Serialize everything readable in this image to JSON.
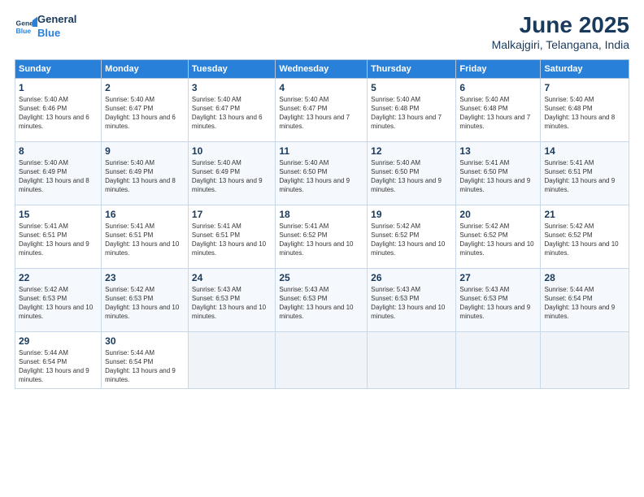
{
  "logo": {
    "line1": "General",
    "line2": "Blue"
  },
  "title": "June 2025",
  "subtitle": "Malkajgiri, Telangana, India",
  "weekdays": [
    "Sunday",
    "Monday",
    "Tuesday",
    "Wednesday",
    "Thursday",
    "Friday",
    "Saturday"
  ],
  "weeks": [
    [
      {
        "day": "1",
        "sunrise": "Sunrise: 5:40 AM",
        "sunset": "Sunset: 6:46 PM",
        "daylight": "Daylight: 13 hours and 6 minutes."
      },
      {
        "day": "2",
        "sunrise": "Sunrise: 5:40 AM",
        "sunset": "Sunset: 6:47 PM",
        "daylight": "Daylight: 13 hours and 6 minutes."
      },
      {
        "day": "3",
        "sunrise": "Sunrise: 5:40 AM",
        "sunset": "Sunset: 6:47 PM",
        "daylight": "Daylight: 13 hours and 6 minutes."
      },
      {
        "day": "4",
        "sunrise": "Sunrise: 5:40 AM",
        "sunset": "Sunset: 6:47 PM",
        "daylight": "Daylight: 13 hours and 7 minutes."
      },
      {
        "day": "5",
        "sunrise": "Sunrise: 5:40 AM",
        "sunset": "Sunset: 6:48 PM",
        "daylight": "Daylight: 13 hours and 7 minutes."
      },
      {
        "day": "6",
        "sunrise": "Sunrise: 5:40 AM",
        "sunset": "Sunset: 6:48 PM",
        "daylight": "Daylight: 13 hours and 7 minutes."
      },
      {
        "day": "7",
        "sunrise": "Sunrise: 5:40 AM",
        "sunset": "Sunset: 6:48 PM",
        "daylight": "Daylight: 13 hours and 8 minutes."
      }
    ],
    [
      {
        "day": "8",
        "sunrise": "Sunrise: 5:40 AM",
        "sunset": "Sunset: 6:49 PM",
        "daylight": "Daylight: 13 hours and 8 minutes."
      },
      {
        "day": "9",
        "sunrise": "Sunrise: 5:40 AM",
        "sunset": "Sunset: 6:49 PM",
        "daylight": "Daylight: 13 hours and 8 minutes."
      },
      {
        "day": "10",
        "sunrise": "Sunrise: 5:40 AM",
        "sunset": "Sunset: 6:49 PM",
        "daylight": "Daylight: 13 hours and 9 minutes."
      },
      {
        "day": "11",
        "sunrise": "Sunrise: 5:40 AM",
        "sunset": "Sunset: 6:50 PM",
        "daylight": "Daylight: 13 hours and 9 minutes."
      },
      {
        "day": "12",
        "sunrise": "Sunrise: 5:40 AM",
        "sunset": "Sunset: 6:50 PM",
        "daylight": "Daylight: 13 hours and 9 minutes."
      },
      {
        "day": "13",
        "sunrise": "Sunrise: 5:41 AM",
        "sunset": "Sunset: 6:50 PM",
        "daylight": "Daylight: 13 hours and 9 minutes."
      },
      {
        "day": "14",
        "sunrise": "Sunrise: 5:41 AM",
        "sunset": "Sunset: 6:51 PM",
        "daylight": "Daylight: 13 hours and 9 minutes."
      }
    ],
    [
      {
        "day": "15",
        "sunrise": "Sunrise: 5:41 AM",
        "sunset": "Sunset: 6:51 PM",
        "daylight": "Daylight: 13 hours and 9 minutes."
      },
      {
        "day": "16",
        "sunrise": "Sunrise: 5:41 AM",
        "sunset": "Sunset: 6:51 PM",
        "daylight": "Daylight: 13 hours and 10 minutes."
      },
      {
        "day": "17",
        "sunrise": "Sunrise: 5:41 AM",
        "sunset": "Sunset: 6:51 PM",
        "daylight": "Daylight: 13 hours and 10 minutes."
      },
      {
        "day": "18",
        "sunrise": "Sunrise: 5:41 AM",
        "sunset": "Sunset: 6:52 PM",
        "daylight": "Daylight: 13 hours and 10 minutes."
      },
      {
        "day": "19",
        "sunrise": "Sunrise: 5:42 AM",
        "sunset": "Sunset: 6:52 PM",
        "daylight": "Daylight: 13 hours and 10 minutes."
      },
      {
        "day": "20",
        "sunrise": "Sunrise: 5:42 AM",
        "sunset": "Sunset: 6:52 PM",
        "daylight": "Daylight: 13 hours and 10 minutes."
      },
      {
        "day": "21",
        "sunrise": "Sunrise: 5:42 AM",
        "sunset": "Sunset: 6:52 PM",
        "daylight": "Daylight: 13 hours and 10 minutes."
      }
    ],
    [
      {
        "day": "22",
        "sunrise": "Sunrise: 5:42 AM",
        "sunset": "Sunset: 6:53 PM",
        "daylight": "Daylight: 13 hours and 10 minutes."
      },
      {
        "day": "23",
        "sunrise": "Sunrise: 5:42 AM",
        "sunset": "Sunset: 6:53 PM",
        "daylight": "Daylight: 13 hours and 10 minutes."
      },
      {
        "day": "24",
        "sunrise": "Sunrise: 5:43 AM",
        "sunset": "Sunset: 6:53 PM",
        "daylight": "Daylight: 13 hours and 10 minutes."
      },
      {
        "day": "25",
        "sunrise": "Sunrise: 5:43 AM",
        "sunset": "Sunset: 6:53 PM",
        "daylight": "Daylight: 13 hours and 10 minutes."
      },
      {
        "day": "26",
        "sunrise": "Sunrise: 5:43 AM",
        "sunset": "Sunset: 6:53 PM",
        "daylight": "Daylight: 13 hours and 10 minutes."
      },
      {
        "day": "27",
        "sunrise": "Sunrise: 5:43 AM",
        "sunset": "Sunset: 6:53 PM",
        "daylight": "Daylight: 13 hours and 9 minutes."
      },
      {
        "day": "28",
        "sunrise": "Sunrise: 5:44 AM",
        "sunset": "Sunset: 6:54 PM",
        "daylight": "Daylight: 13 hours and 9 minutes."
      }
    ],
    [
      {
        "day": "29",
        "sunrise": "Sunrise: 5:44 AM",
        "sunset": "Sunset: 6:54 PM",
        "daylight": "Daylight: 13 hours and 9 minutes."
      },
      {
        "day": "30",
        "sunrise": "Sunrise: 5:44 AM",
        "sunset": "Sunset: 6:54 PM",
        "daylight": "Daylight: 13 hours and 9 minutes."
      },
      null,
      null,
      null,
      null,
      null
    ]
  ]
}
